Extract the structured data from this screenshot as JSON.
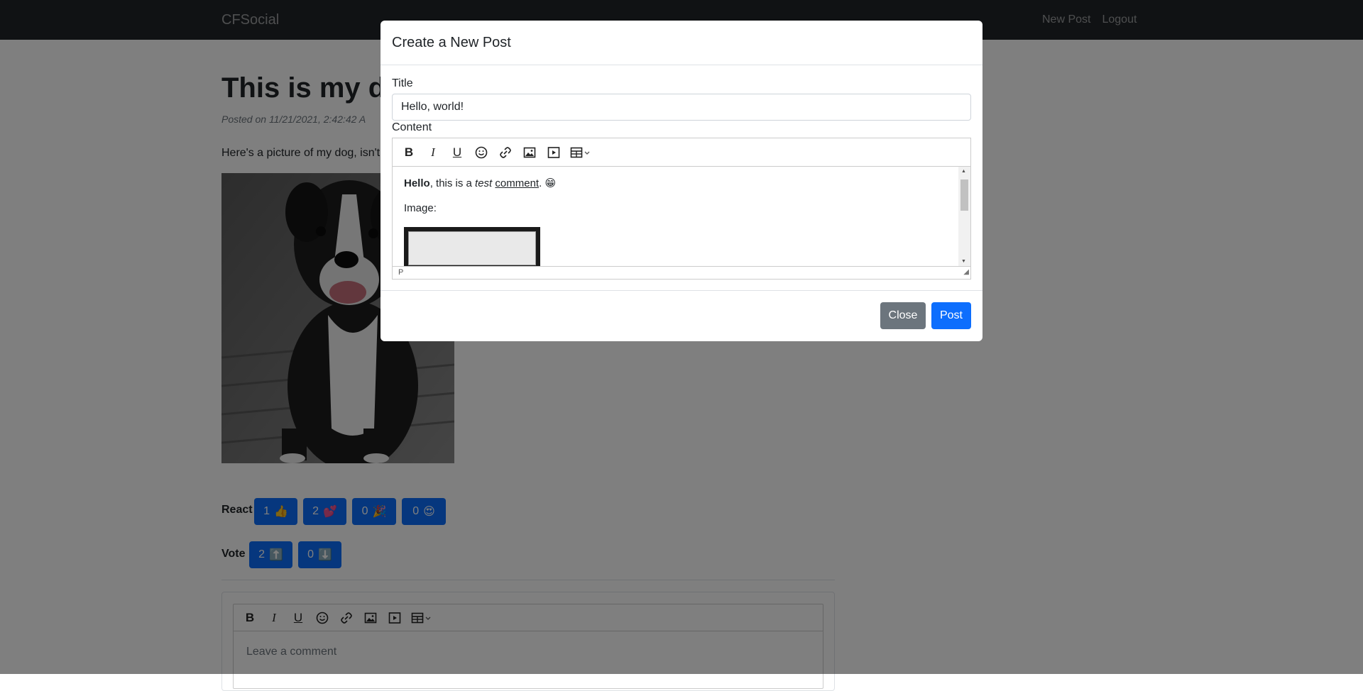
{
  "navbar": {
    "brand": "CFSocial",
    "links": [
      "New Post",
      "Logout"
    ]
  },
  "post": {
    "title": "This is my d",
    "meta": "Posted on 11/21/2021, 2:42:42 A",
    "body": "Here's a picture of my dog, isn't"
  },
  "reactions": {
    "label": "React",
    "buttons": [
      {
        "count": "1",
        "emoji": "👍"
      },
      {
        "count": "2",
        "emoji": "💕"
      },
      {
        "count": "0",
        "emoji": "🎉"
      },
      {
        "count": "0",
        "emoji": "😍"
      }
    ]
  },
  "votes": {
    "label": "Vote",
    "buttons": [
      {
        "count": "2",
        "emoji": "⬆️"
      },
      {
        "count": "0",
        "emoji": "⬇️"
      }
    ]
  },
  "comment": {
    "placeholder": "Leave a comment"
  },
  "modal": {
    "title": "Create a New Post",
    "title_label": "Title",
    "title_value": "Hello, world!",
    "content_label": "Content",
    "content": {
      "bold": "Hello",
      "text1": ", this is a ",
      "italic": "test",
      "underline": "comment",
      "emoji": "😁",
      "image_label": "Image:"
    },
    "status_path": "P",
    "close_label": "Close",
    "post_label": "Post"
  },
  "colors": {
    "primary": "#0d6efd",
    "secondary": "#6c757d",
    "navbar": "#212529"
  }
}
